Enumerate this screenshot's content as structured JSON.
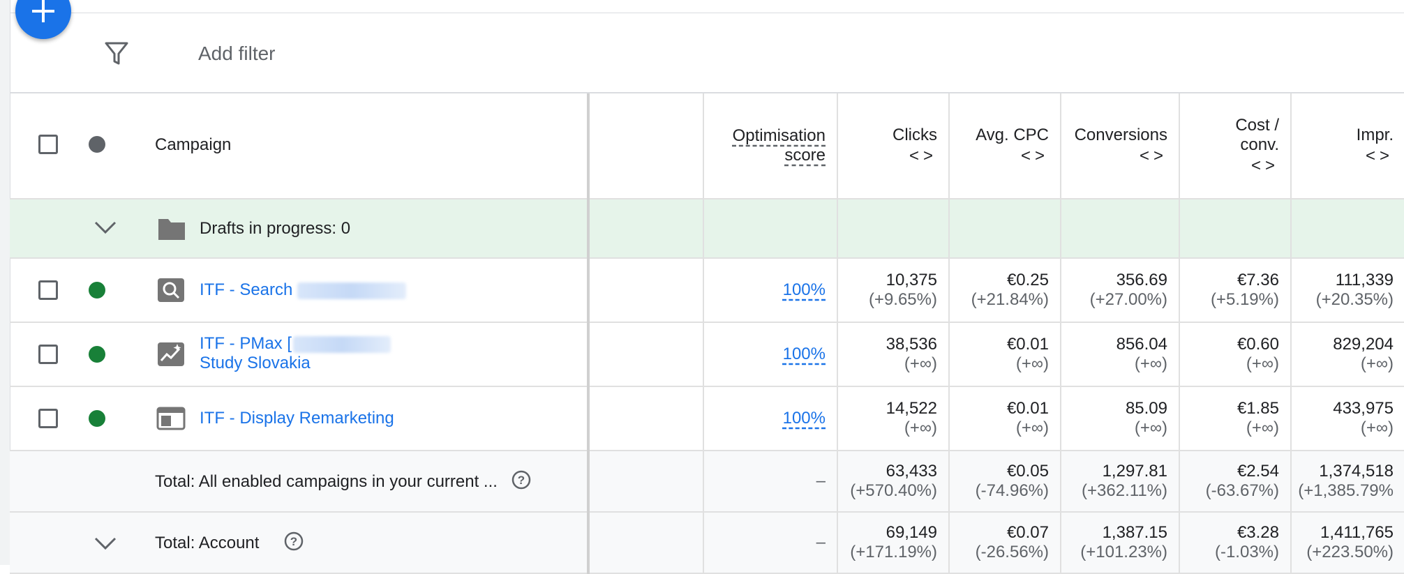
{
  "toolbar": {
    "add_filter": "Add filter"
  },
  "columns": {
    "campaign": "Campaign",
    "optimisation_score_line1": "Optimisation",
    "optimisation_score_line2": "score",
    "clicks": "Clicks",
    "avg_cpc": "Avg. CPC",
    "conversions": "Conversions",
    "cost_conv_line1": "Cost /",
    "cost_conv_line2": "conv.",
    "impr": "Impr.",
    "sort_arrows": "<>"
  },
  "drafts": {
    "label": "Drafts in progress: 0"
  },
  "campaigns": [
    {
      "name": "ITF - Search",
      "name_line2": "",
      "type_icon": "search-campaign-icon",
      "status": "enabled",
      "opt_score": "100%",
      "clicks": "10,375",
      "clicks_change": "(+9.65%)",
      "avg_cpc": "€0.25",
      "avg_cpc_change": "(+21.84%)",
      "conversions": "356.69",
      "conversions_change": "(+27.00%)",
      "cost_conv": "€7.36",
      "cost_conv_change": "(+5.19%)",
      "impr": "111,339",
      "impr_change": "(+20.35%)"
    },
    {
      "name": "ITF - PMax [",
      "name_line2": "Study Slovakia",
      "type_icon": "performance-max-icon",
      "status": "enabled",
      "opt_score": "100%",
      "clicks": "38,536",
      "clicks_change": "(+∞)",
      "avg_cpc": "€0.01",
      "avg_cpc_change": "(+∞)",
      "conversions": "856.04",
      "conversions_change": "(+∞)",
      "cost_conv": "€0.60",
      "cost_conv_change": "(+∞)",
      "impr": "829,204",
      "impr_change": "(+∞)"
    },
    {
      "name": "ITF - Display Remarketing",
      "name_line2": "",
      "type_icon": "display-campaign-icon",
      "status": "enabled",
      "opt_score": "100%",
      "clicks": "14,522",
      "clicks_change": "(+∞)",
      "avg_cpc": "€0.01",
      "avg_cpc_change": "(+∞)",
      "conversions": "85.09",
      "conversions_change": "(+∞)",
      "cost_conv": "€1.85",
      "cost_conv_change": "(+∞)",
      "impr": "433,975",
      "impr_change": "(+∞)"
    }
  ],
  "total_enabled": {
    "label": "Total: All enabled campaigns in your current ...",
    "opt_score": "–",
    "clicks": "63,433",
    "clicks_change": "(+570.40%)",
    "avg_cpc": "€0.05",
    "avg_cpc_change": "(-74.96%)",
    "conversions": "1,297.81",
    "conversions_change": "(+362.11%)",
    "cost_conv": "€2.54",
    "cost_conv_change": "(-63.67%)",
    "impr": "1,374,518",
    "impr_change": "(+1,385.79%"
  },
  "total_account": {
    "label": "Total: Account",
    "opt_score": "–",
    "clicks": "69,149",
    "clicks_change": "(+171.19%)",
    "avg_cpc": "€0.07",
    "avg_cpc_change": "(-26.56%)",
    "conversions": "1,387.15",
    "conversions_change": "(+101.23%)",
    "cost_conv": "€3.28",
    "cost_conv_change": "(-1.03%)",
    "impr": "1,411,765",
    "impr_change": "(+223.50%)"
  },
  "colors": {
    "accent": "#1a73e8",
    "status_enabled": "#188038",
    "draft_row_bg": "#e6f4ea"
  }
}
